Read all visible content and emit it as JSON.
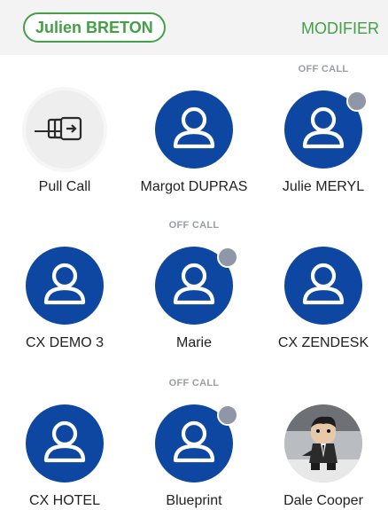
{
  "header": {
    "user_name": "Julien BRETON",
    "modify_label": "MODIFIER"
  },
  "colors": {
    "accent_green": "#43a047",
    "avatar_blue": "#0d47a1",
    "status_grey": "#8e96a8"
  },
  "contacts": [
    {
      "name": "Pull Call",
      "icon": "pull-call-icon",
      "status": ""
    },
    {
      "name": "Margot DUPRAS",
      "icon": "person-icon",
      "status": ""
    },
    {
      "name": "Julie MERYL",
      "icon": "person-icon",
      "status": "OFF CALL"
    },
    {
      "name": "CX DEMO 3",
      "icon": "person-icon",
      "status": ""
    },
    {
      "name": "Marie",
      "icon": "person-icon",
      "status": "OFF CALL"
    },
    {
      "name": "CX ZENDESK",
      "icon": "person-icon",
      "status": ""
    },
    {
      "name": "CX HOTEL",
      "icon": "person-icon",
      "status": ""
    },
    {
      "name": "Blueprint",
      "icon": "person-icon",
      "status": "OFF CALL"
    },
    {
      "name": "Dale Cooper",
      "icon": "photo-avatar",
      "status": ""
    }
  ]
}
